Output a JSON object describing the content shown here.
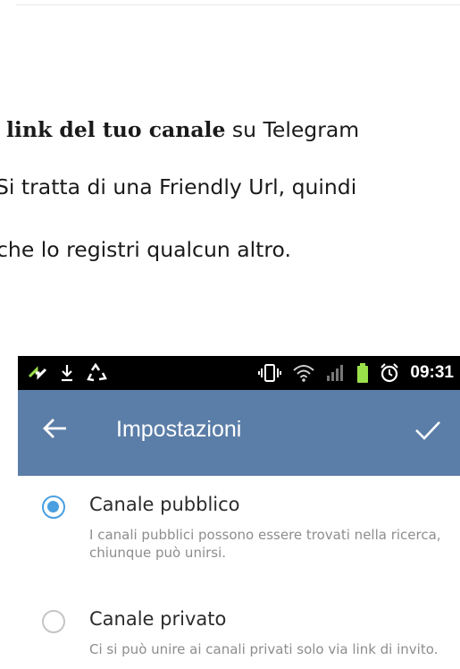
{
  "article": {
    "line1_bold": "link del tuo canale",
    "line1_rest": " su Telegram",
    "line2": "Si tratta di una Friendly Url, quindi",
    "line3": "che lo registri qualcun altro."
  },
  "phone": {
    "statusbar": {
      "time": "09:31",
      "left_icons": [
        "swap-arrows-icon",
        "download-icon",
        "recycle-icon"
      ],
      "right_icons": [
        "vibrate-icon",
        "wifi-icon",
        "signal-icon",
        "battery-icon",
        "alarm-icon"
      ]
    },
    "appbar": {
      "title": "Impostazioni",
      "color": "#5b7ea8"
    },
    "options": [
      {
        "title": "Canale pubblico",
        "description": "I canali pubblici possono essere trovati nella ricerca, chiunque può unirsi.",
        "selected": true
      },
      {
        "title": "Canale privato",
        "description": "Ci si può unire ai canali privati solo via link di invito.",
        "selected": false
      }
    ],
    "accent": "#4a9fe0"
  }
}
